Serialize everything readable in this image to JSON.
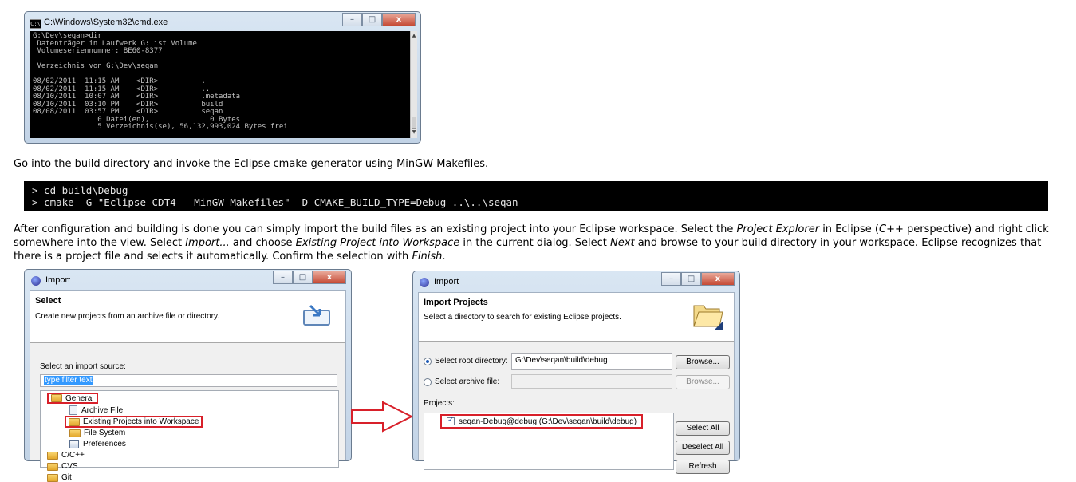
{
  "cmd": {
    "title": "C:\\Windows\\System32\\cmd.exe",
    "console": "G:\\Dev\\seqan>dir\n Datenträger in Laufwerk G: ist Volume\n Volumeseriennummer: BE60-8377\n\n Verzeichnis von G:\\Dev\\seqan\n\n08/02/2011  11:15 AM    <DIR>          .\n08/02/2011  11:15 AM    <DIR>          ..\n08/10/2011  10:07 AM    <DIR>          .metadata\n08/10/2011  03:10 PM    <DIR>          build\n08/08/2011  03:57 PM    <DIR>          seqan\n               0 Datei(en),              0 Bytes\n               5 Verzeichnis(se), 56,132,993,024 Bytes frei\n\nG:\\Dev\\seqan>"
  },
  "doc": {
    "p1": "Go into the build directory and invoke the Eclipse cmake generator using MinGW Makefiles.",
    "code": "> cd build\\Debug\n> cmake -G \"Eclipse CDT4 - MinGW Makefiles\" -D CMAKE_BUILD_TYPE=Debug ..\\..\\seqan",
    "p2": {
      "s1": "After configuration and building is done you can simply import the build files as an existing project into your Eclipse workspace. Select the ",
      "e1": "Project Explorer",
      "s2": " in Eclipse (",
      "e2": "C++",
      "s3": " perspective) and right click somewhere into the view. Select ",
      "e3": "Import...",
      "s4": " and choose ",
      "e4": "Existing Project into Workspace",
      "s5": " in the current dialog. Select ",
      "e5": "Next",
      "s6": " and browse to your build directory in your workspace. Eclipse recognizes that there is a project file and selects it automatically. Confirm the selection with ",
      "e6": "Finish",
      "s7": "."
    }
  },
  "dialog1": {
    "title": "Import",
    "header_title": "Select",
    "header_desc": "Create new projects from an archive file or directory.",
    "source_label": "Select an import source:",
    "filter_value": "type filter text",
    "tree": {
      "general": "General",
      "archive": "Archive File",
      "existing": "Existing Projects into Workspace",
      "filesystem": "File System",
      "preferences": "Preferences",
      "cpp": "C/C++",
      "cvs": "CVS",
      "git": "Git"
    }
  },
  "dialog2": {
    "title": "Import",
    "header_title": "Import Projects",
    "header_desc": "Select a directory to search for existing Eclipse projects.",
    "root_label": "Select root directory:",
    "root_value": "G:\\Dev\\seqan\\build\\debug",
    "archive_label": "Select archive file:",
    "browse1": "Browse...",
    "browse2": "Browse...",
    "projects_label": "Projects:",
    "project_item": "seqan-Debug@debug (G:\\Dev\\seqan\\build\\debug)",
    "select_all": "Select All",
    "deselect_all": "Deselect All",
    "refresh": "Refresh"
  },
  "window_controls": {
    "minimize": "–",
    "maximize": "□",
    "close": "x"
  },
  "colors": {
    "highlight": "#d8202a",
    "arrow": "#d8202a"
  }
}
